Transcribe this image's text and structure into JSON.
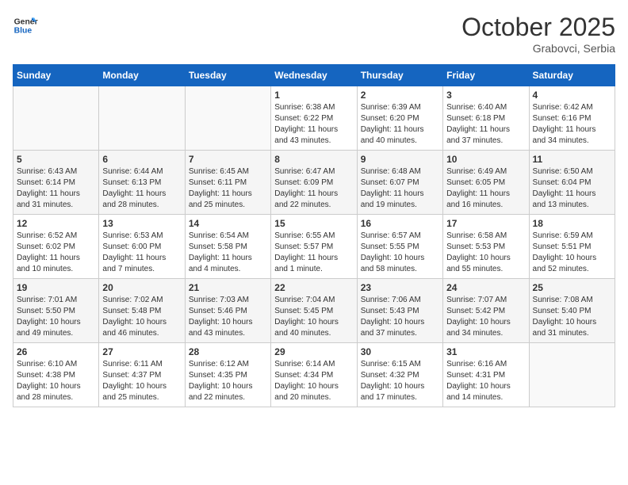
{
  "header": {
    "logo_general": "General",
    "logo_blue": "Blue",
    "month": "October 2025",
    "location": "Grabovci, Serbia"
  },
  "days_of_week": [
    "Sunday",
    "Monday",
    "Tuesday",
    "Wednesday",
    "Thursday",
    "Friday",
    "Saturday"
  ],
  "weeks": [
    [
      {
        "day": "",
        "info": ""
      },
      {
        "day": "",
        "info": ""
      },
      {
        "day": "",
        "info": ""
      },
      {
        "day": "1",
        "info": "Sunrise: 6:38 AM\nSunset: 6:22 PM\nDaylight: 11 hours\nand 43 minutes."
      },
      {
        "day": "2",
        "info": "Sunrise: 6:39 AM\nSunset: 6:20 PM\nDaylight: 11 hours\nand 40 minutes."
      },
      {
        "day": "3",
        "info": "Sunrise: 6:40 AM\nSunset: 6:18 PM\nDaylight: 11 hours\nand 37 minutes."
      },
      {
        "day": "4",
        "info": "Sunrise: 6:42 AM\nSunset: 6:16 PM\nDaylight: 11 hours\nand 34 minutes."
      }
    ],
    [
      {
        "day": "5",
        "info": "Sunrise: 6:43 AM\nSunset: 6:14 PM\nDaylight: 11 hours\nand 31 minutes."
      },
      {
        "day": "6",
        "info": "Sunrise: 6:44 AM\nSunset: 6:13 PM\nDaylight: 11 hours\nand 28 minutes."
      },
      {
        "day": "7",
        "info": "Sunrise: 6:45 AM\nSunset: 6:11 PM\nDaylight: 11 hours\nand 25 minutes."
      },
      {
        "day": "8",
        "info": "Sunrise: 6:47 AM\nSunset: 6:09 PM\nDaylight: 11 hours\nand 22 minutes."
      },
      {
        "day": "9",
        "info": "Sunrise: 6:48 AM\nSunset: 6:07 PM\nDaylight: 11 hours\nand 19 minutes."
      },
      {
        "day": "10",
        "info": "Sunrise: 6:49 AM\nSunset: 6:05 PM\nDaylight: 11 hours\nand 16 minutes."
      },
      {
        "day": "11",
        "info": "Sunrise: 6:50 AM\nSunset: 6:04 PM\nDaylight: 11 hours\nand 13 minutes."
      }
    ],
    [
      {
        "day": "12",
        "info": "Sunrise: 6:52 AM\nSunset: 6:02 PM\nDaylight: 11 hours\nand 10 minutes."
      },
      {
        "day": "13",
        "info": "Sunrise: 6:53 AM\nSunset: 6:00 PM\nDaylight: 11 hours\nand 7 minutes."
      },
      {
        "day": "14",
        "info": "Sunrise: 6:54 AM\nSunset: 5:58 PM\nDaylight: 11 hours\nand 4 minutes."
      },
      {
        "day": "15",
        "info": "Sunrise: 6:55 AM\nSunset: 5:57 PM\nDaylight: 11 hours\nand 1 minute."
      },
      {
        "day": "16",
        "info": "Sunrise: 6:57 AM\nSunset: 5:55 PM\nDaylight: 10 hours\nand 58 minutes."
      },
      {
        "day": "17",
        "info": "Sunrise: 6:58 AM\nSunset: 5:53 PM\nDaylight: 10 hours\nand 55 minutes."
      },
      {
        "day": "18",
        "info": "Sunrise: 6:59 AM\nSunset: 5:51 PM\nDaylight: 10 hours\nand 52 minutes."
      }
    ],
    [
      {
        "day": "19",
        "info": "Sunrise: 7:01 AM\nSunset: 5:50 PM\nDaylight: 10 hours\nand 49 minutes."
      },
      {
        "day": "20",
        "info": "Sunrise: 7:02 AM\nSunset: 5:48 PM\nDaylight: 10 hours\nand 46 minutes."
      },
      {
        "day": "21",
        "info": "Sunrise: 7:03 AM\nSunset: 5:46 PM\nDaylight: 10 hours\nand 43 minutes."
      },
      {
        "day": "22",
        "info": "Sunrise: 7:04 AM\nSunset: 5:45 PM\nDaylight: 10 hours\nand 40 minutes."
      },
      {
        "day": "23",
        "info": "Sunrise: 7:06 AM\nSunset: 5:43 PM\nDaylight: 10 hours\nand 37 minutes."
      },
      {
        "day": "24",
        "info": "Sunrise: 7:07 AM\nSunset: 5:42 PM\nDaylight: 10 hours\nand 34 minutes."
      },
      {
        "day": "25",
        "info": "Sunrise: 7:08 AM\nSunset: 5:40 PM\nDaylight: 10 hours\nand 31 minutes."
      }
    ],
    [
      {
        "day": "26",
        "info": "Sunrise: 6:10 AM\nSunset: 4:38 PM\nDaylight: 10 hours\nand 28 minutes."
      },
      {
        "day": "27",
        "info": "Sunrise: 6:11 AM\nSunset: 4:37 PM\nDaylight: 10 hours\nand 25 minutes."
      },
      {
        "day": "28",
        "info": "Sunrise: 6:12 AM\nSunset: 4:35 PM\nDaylight: 10 hours\nand 22 minutes."
      },
      {
        "day": "29",
        "info": "Sunrise: 6:14 AM\nSunset: 4:34 PM\nDaylight: 10 hours\nand 20 minutes."
      },
      {
        "day": "30",
        "info": "Sunrise: 6:15 AM\nSunset: 4:32 PM\nDaylight: 10 hours\nand 17 minutes."
      },
      {
        "day": "31",
        "info": "Sunrise: 6:16 AM\nSunset: 4:31 PM\nDaylight: 10 hours\nand 14 minutes."
      },
      {
        "day": "",
        "info": ""
      }
    ]
  ]
}
